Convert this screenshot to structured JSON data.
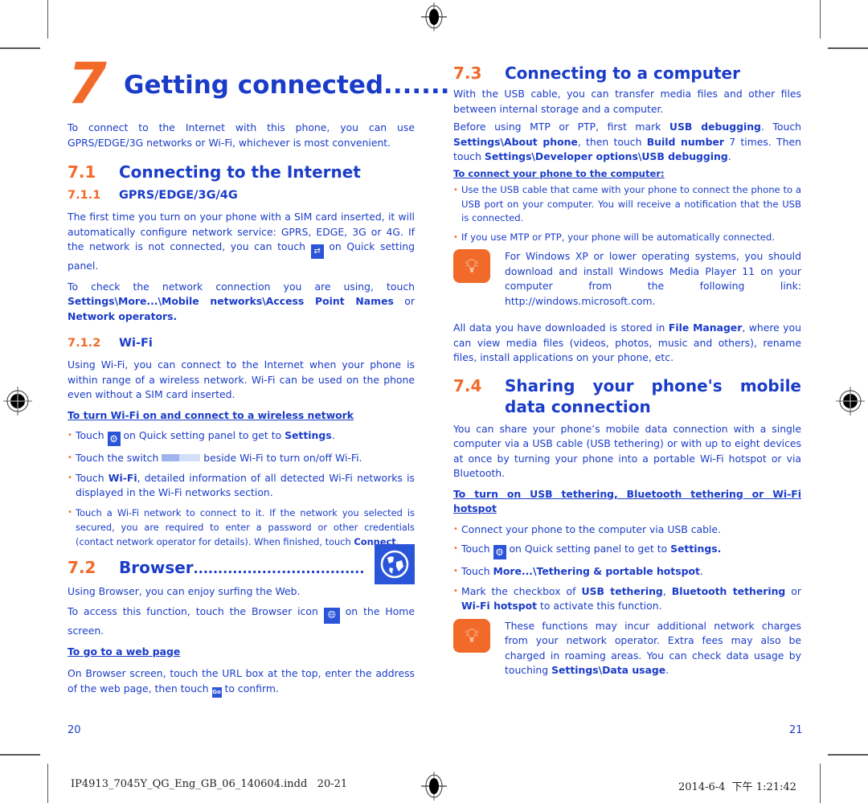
{
  "chapter": {
    "number": "7",
    "title": "Getting connected",
    "leader": ".......",
    "intro": "To connect to the Internet with this phone, you can use GPRS/EDGE/3G networks or Wi-Fi, whichever is most convenient."
  },
  "s71": {
    "number": "7.1",
    "title": "Connecting to the Internet",
    "s711": {
      "number": "7.1.1",
      "title": "GPRS/EDGE/3G/4G",
      "p1_a": "The first time you turn on your phone with a SIM card inserted, it will automatically configure network service: GPRS, EDGE, 3G or 4G. If the network is not connected, you can touch",
      "p1_b": "on Quick setting panel.",
      "p2_a": "To check the network connection you are using, touch",
      "p2_b1": "Settings\\More...\\Mobile networks\\Access Point Names",
      "p2_c": "or",
      "p2_b2": "Network operators."
    },
    "s712": {
      "number": "7.1.2",
      "title": "Wi-Fi",
      "p1": "Using Wi-Fi, you can connect to the Internet when your phone is within range of a wireless network. Wi-Fi can be used on the phone even without a SIM card inserted.",
      "link": "To turn Wi-Fi on and connect to a wireless network",
      "b1_a": "Touch",
      "b1_b": "on Quick setting panel to get to",
      "b1_c": "Settings",
      "b1_d": ".",
      "b2_a": "Touch the switch",
      "b2_b": "beside Wi-Fi to turn on/off Wi-Fi.",
      "b3_a": "Touch",
      "b3_b": "Wi-Fi",
      "b3_c": ", detailed information of all detected Wi-Fi networks is displayed in the Wi-Fi networks section.",
      "b4_a": "Touch a Wi-Fi network to connect to it. If the network you selected is secured, you are required to enter a password or other credentials (contact network operator for details). When finished, touch",
      "b4_b": "Connect",
      "b4_c": "."
    }
  },
  "s72": {
    "number": "7.2",
    "title": "Browser",
    "leader": "...................................",
    "p1": "Using Browser, you can enjoy surfing the Web.",
    "p2_a": "To access this function, touch the Browser icon",
    "p2_b": "on the Home screen.",
    "link": "To go to a web page",
    "p3_a": "On Browser screen, touch the URL box at the top, enter the address of the web page, then touch",
    "p3_b": "to confirm.",
    "go_label": "Go"
  },
  "s73": {
    "number": "7.3",
    "title": "Connecting to a computer",
    "p1": "With the USB cable, you can transfer media files and other files between internal storage and a computer.",
    "p2_a": "Before using MTP or PTP, first mark",
    "p2_b": "USB debugging",
    "p2_c": ". Touch",
    "p2_d": "Settings\\About phone",
    "p2_e": ", then touch",
    "p2_f": "Build number",
    "p2_g": "7 times. Then touch",
    "p2_h": "Settings\\Developer options\\USB debugging",
    "p2_i": ".",
    "link": "To connect your phone to the computer:",
    "b1": "Use the USB cable that came with your phone to connect the phone to a USB port on your computer. You will receive a notification that the USB is connected.",
    "b2": "If you use MTP or PTP, your phone will be automatically connected.",
    "tip": "For Windows XP or lower operating systems, you should download and install Windows Media Player 11 on your computer from the following link: http://windows.microsoft.com.",
    "p3_a": "All data you have downloaded is stored in",
    "p3_b": "File Manager",
    "p3_c": ", where you can view media files (videos, photos, music and others), rename files, install applications on your phone, etc."
  },
  "s74": {
    "number": "7.4",
    "title": "Sharing your phone's mobile data connection",
    "p1": "You can share your phone’s mobile data connection with a single computer via a USB cable (USB tethering) or with up to eight devices at once by turning your phone into a portable Wi-Fi hotspot or via Bluetooth.",
    "link": "To turn on USB tethering, Bluetooth tethering or Wi-Fi hotspot",
    "b1": "Connect your phone to the computer via USB cable.",
    "b2_a": "Touch",
    "b2_b": "on Quick setting panel to get to",
    "b2_c": "Settings.",
    "b3_a": "Touch",
    "b3_b": "More...\\Tethering & portable hotspot",
    "b3_c": ".",
    "b4_a": "Mark the checkbox of",
    "b4_b": "USB tethering",
    "b4_c": ",",
    "b4_d": "Bluetooth tethering",
    "b4_e": "or",
    "b4_f": "Wi-Fi hotspot",
    "b4_g": "to activate this function.",
    "tip_a": "These functions may incur additional network charges from your network operator. Extra fees may also be charged in roaming areas. You can check data usage by touching",
    "tip_b": "Settings\\Data usage",
    "tip_c": "."
  },
  "footer": {
    "page_left": "20",
    "page_right": "21",
    "slug_file": "IP4913_7045Y_QG_Eng_GB_06_140604.indd   20-21",
    "slug_date": "2014-6-4  下午 1:21:42"
  },
  "colors": {
    "text_blue": "#1a3cc8",
    "accent_orange": "#f26a2a",
    "icon_blue": "#2a55d8"
  }
}
